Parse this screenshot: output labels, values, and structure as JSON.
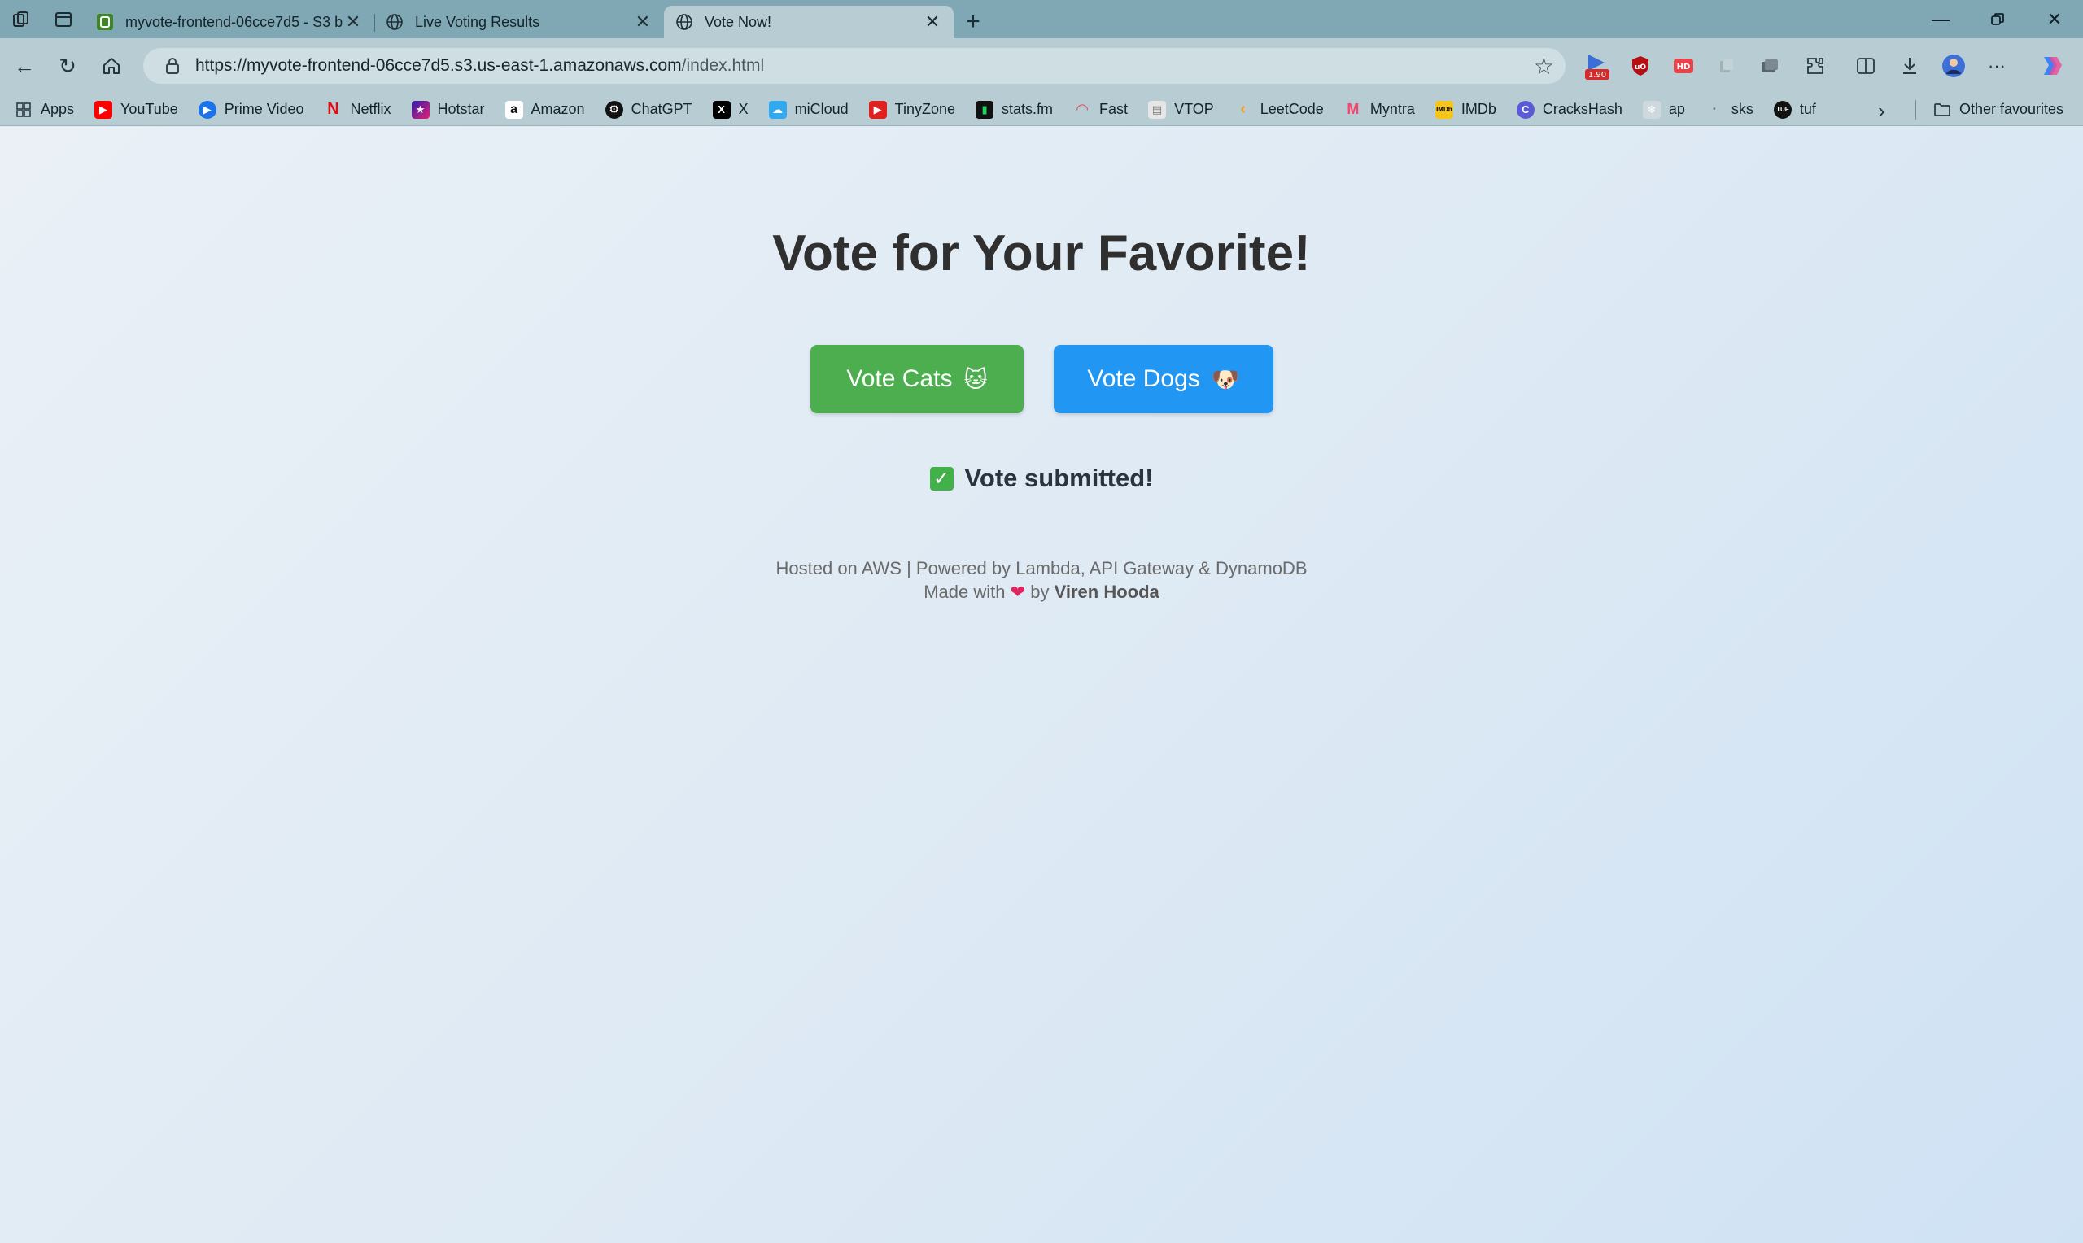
{
  "browser": {
    "tabs": [
      {
        "title": "myvote-frontend-06cce7d5 - S3 b",
        "active": false,
        "favicon": "s3-bucket-icon"
      },
      {
        "title": "Live Voting Results",
        "active": false,
        "favicon": "globe-icon"
      },
      {
        "title": "Vote Now!",
        "active": true,
        "favicon": "globe-icon"
      }
    ],
    "url": {
      "host": "https://myvote-frontend-06cce7d5.s3.us-east-1.amazonaws.com",
      "path": "/index.html"
    },
    "extension_badge": "1.90",
    "bookmarks": [
      {
        "label": "Apps",
        "icon": "apps-grid-icon",
        "color": "#2b3a40"
      },
      {
        "label": "YouTube",
        "icon": "youtube-icon",
        "color": "#ff0000"
      },
      {
        "label": "Prime Video",
        "icon": "prime-video-icon",
        "color": "#1a73e8"
      },
      {
        "label": "Netflix",
        "icon": "netflix-icon",
        "color": "#e50914"
      },
      {
        "label": "Hotstar",
        "icon": "hotstar-icon",
        "color": "#3b1fa8"
      },
      {
        "label": "Amazon",
        "icon": "amazon-icon",
        "color": "#ffffff"
      },
      {
        "label": "ChatGPT",
        "icon": "chatgpt-icon",
        "color": "#111111"
      },
      {
        "label": "X",
        "icon": "x-icon",
        "color": "#000000"
      },
      {
        "label": "miCloud",
        "icon": "micloud-icon",
        "color": "#31a9f1"
      },
      {
        "label": "TinyZone",
        "icon": "tinyzone-icon",
        "color": "#e0201e"
      },
      {
        "label": "stats.fm",
        "icon": "statsfm-icon",
        "color": "#111111"
      },
      {
        "label": "Fast",
        "icon": "fast-icon",
        "color": "#e3455e"
      },
      {
        "label": "VTOP",
        "icon": "vtop-icon",
        "color": "#dddddd"
      },
      {
        "label": "LeetCode",
        "icon": "leetcode-icon",
        "color": "#f89f1b"
      },
      {
        "label": "Myntra",
        "icon": "myntra-icon",
        "color": "#ff3f6c"
      },
      {
        "label": "IMDb",
        "icon": "imdb-icon",
        "color": "#f5c518"
      },
      {
        "label": "CracksHash",
        "icon": "crackshash-icon",
        "color": "#5b5bd6"
      },
      {
        "label": "ap",
        "icon": "ap-icon",
        "color": "#cfd8dc"
      },
      {
        "label": "sks",
        "icon": "sks-icon",
        "color": "#b7cdd3"
      },
      {
        "label": "tuf",
        "icon": "tuf-icon",
        "color": "#111111"
      }
    ],
    "other_favourites": "Other favourites"
  },
  "page": {
    "heading": "Vote for Your Favorite!",
    "vote_cats": "Vote Cats",
    "vote_cats_emoji": "🐱",
    "vote_dogs": "Vote Dogs",
    "vote_dogs_emoji": "🐶",
    "status": "Vote submitted!",
    "status_icon": "✓",
    "footer_line1": "Hosted on AWS | Powered by Lambda, API Gateway & DynamoDB",
    "footer_made_with": "Made with",
    "footer_heart": "❤",
    "footer_by": "by",
    "footer_author": "Viren Hooda"
  },
  "colors": {
    "cats_button": "#4cae4f",
    "dogs_button": "#2196f3"
  }
}
